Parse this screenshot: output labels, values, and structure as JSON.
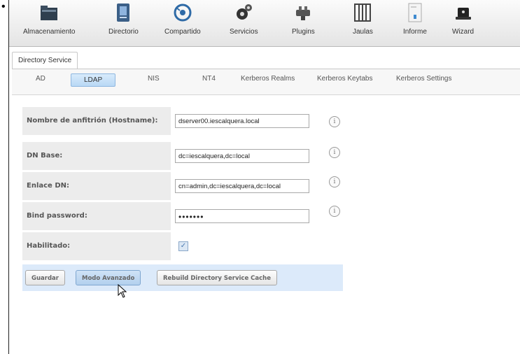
{
  "toolbar": {
    "items": [
      {
        "label": "Almacenamiento",
        "icon": "folder-icon"
      },
      {
        "label": "Directorio",
        "icon": "directory-book-icon"
      },
      {
        "label": "Compartido",
        "icon": "share-icon"
      },
      {
        "label": "Servicios",
        "icon": "gears-icon"
      },
      {
        "label": "Plugins",
        "icon": "plugin-icon"
      },
      {
        "label": "Jaulas",
        "icon": "jail-icon"
      },
      {
        "label": "Informe",
        "icon": "report-icon"
      },
      {
        "label": "Wizard",
        "icon": "wizard-hat-icon"
      }
    ]
  },
  "tab": {
    "label": "Directory Service"
  },
  "subtabs": [
    {
      "label": "AD"
    },
    {
      "label": "LDAP",
      "active": true
    },
    {
      "label": "NIS"
    },
    {
      "label": "NT4"
    },
    {
      "label": "Kerberos Realms"
    },
    {
      "label": "Kerberos Keytabs"
    },
    {
      "label": "Kerberos Settings"
    }
  ],
  "form": {
    "hostname": {
      "label": "Nombre de anfitrión (Hostname):",
      "value": "dserver00.iescalquera.local"
    },
    "basedn": {
      "label": "DN Base:",
      "value": "dc=iescalquera,dc=local"
    },
    "binddn": {
      "label": "Enlace DN:",
      "value": "cn=admin,dc=iescalquera,dc=local"
    },
    "bindpw": {
      "label": "Bind password:",
      "value": "•••••••"
    },
    "enabled": {
      "label": "Habilitado:",
      "checked": true
    }
  },
  "buttons": {
    "save": "Guardar",
    "advanced": "Modo Avanzado",
    "rebuild": "Rebuild Directory Service Cache"
  },
  "colors": {
    "accent": "#b9d8f5",
    "button_bar": "#dceafa"
  }
}
